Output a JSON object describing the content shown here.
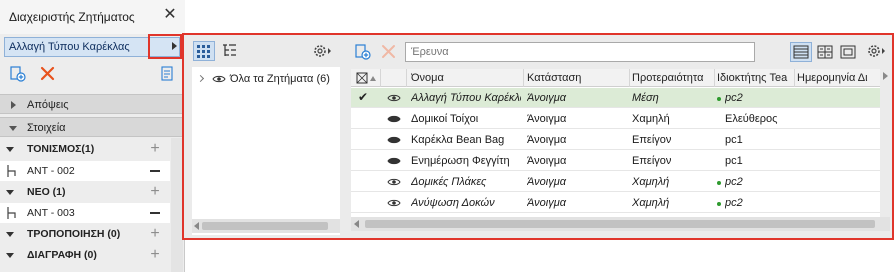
{
  "palette": {
    "title": "Διαχειριστής Ζητήματος",
    "selected_issue": "Αλλαγή Τύπου Καρέκλας",
    "sections": [
      {
        "label": "Απόψεις"
      },
      {
        "label": "Στοιχεία"
      }
    ],
    "groups": [
      {
        "label": "ΤΟΝΙΣΜΟΣ(1)",
        "items": [
          "ANT - 002"
        ]
      },
      {
        "label": "ΝΕΟ (1)",
        "items": [
          "ANT - 003"
        ]
      },
      {
        "label": "ΤΡΟΠΟΠΟΙΗΣΗ (0)",
        "items": []
      },
      {
        "label": "ΔΙΑΓΡΑΦΗ (0)",
        "items": []
      }
    ]
  },
  "main": {
    "tree_root": "Όλα τα Ζητήματα (6)",
    "search_placeholder": "Έρευνα",
    "columns": [
      "Όνομα",
      "Κατάσταση",
      "Προτεραιότητα",
      "Ιδιοκτήτης Tea",
      "Ημερομηνία Δι"
    ],
    "rows": [
      {
        "name": "Αλλαγή Τύπου Καρέκλας",
        "status": "Άνοιγμα",
        "priority": "Μέση",
        "owner": "pc2",
        "owner_dot": true,
        "selected": true
      },
      {
        "name": "Δομικοί Τοίχοι",
        "status": "Άνοιγμα",
        "priority": "Χαμηλή",
        "owner": "Ελεύθερος",
        "owner_dot": false,
        "selected": false
      },
      {
        "name": "Καρέκλα Bean Bag",
        "status": "Άνοιγμα",
        "priority": "Επείγον",
        "owner": "pc1",
        "owner_dot": false,
        "selected": false
      },
      {
        "name": "Ενημέρωση Φεγγίτη",
        "status": "Άνοιγμα",
        "priority": "Επείγον",
        "owner": "pc1",
        "owner_dot": false,
        "selected": false
      },
      {
        "name": "Δομικές Πλάκες",
        "status": "Άνοιγμα",
        "priority": "Χαμηλή",
        "owner": "pc2",
        "owner_dot": true,
        "selected": false
      },
      {
        "name": "Ανύψωση Δοκών",
        "status": "Άνοιγμα",
        "priority": "Χαμηλή",
        "owner": "pc2",
        "owner_dot": true,
        "selected": false
      }
    ]
  },
  "colors": {
    "accent_red": "#e0352b",
    "selection_blue": "#d5e4f4",
    "selected_row_green": "#dcebd6",
    "online_dot": "#2e9a2e",
    "new_issue_blue": "#2a7fd4"
  }
}
